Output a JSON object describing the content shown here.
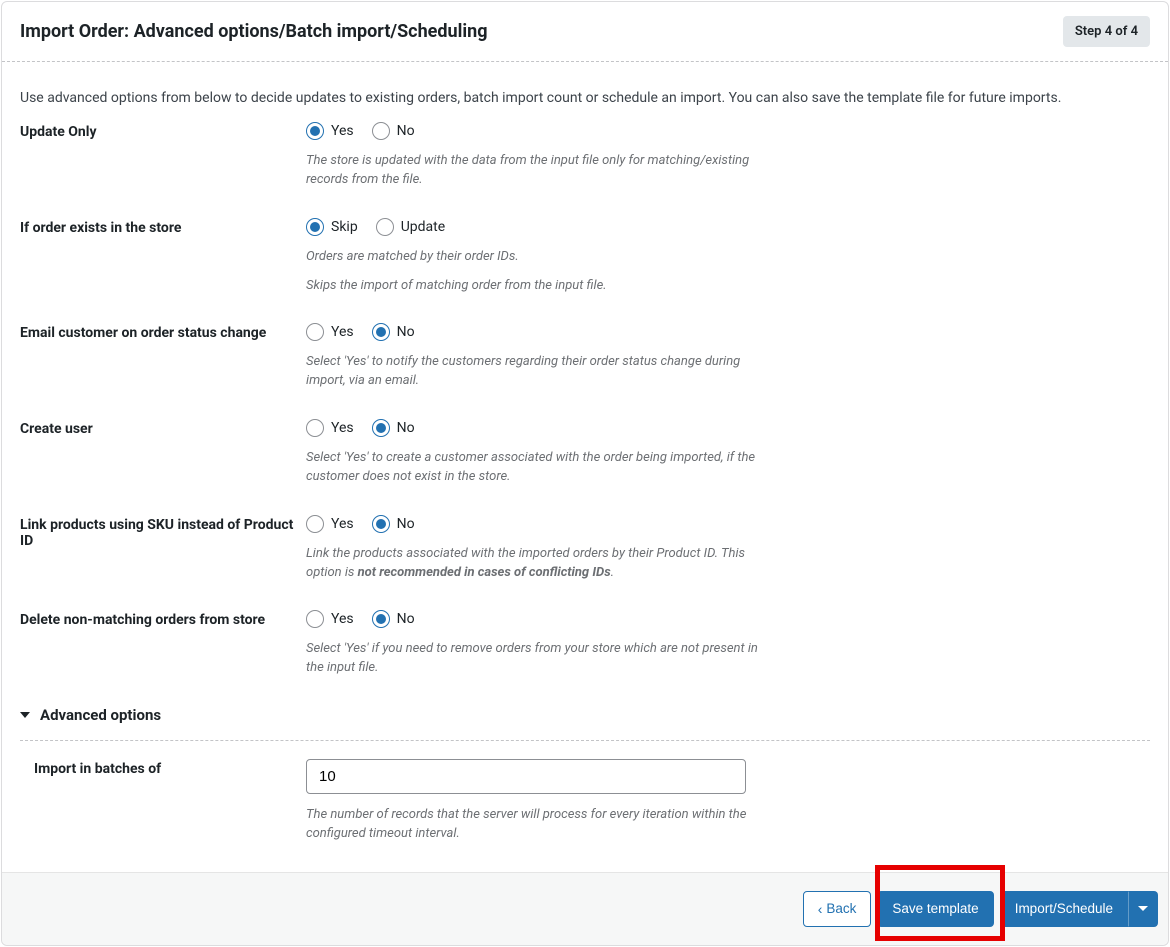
{
  "header": {
    "title": "Import Order: Advanced options/Batch import/Scheduling",
    "step_badge": "Step 4 of 4"
  },
  "intro": "Use advanced options from below to decide updates to existing orders, batch import count or schedule an import. You can also save the template file for future imports.",
  "options": {
    "update_only": {
      "label": "Update Only",
      "yes": "Yes",
      "no": "No",
      "selected": "yes",
      "help": "The store is updated with the data from the input file only for matching/existing records from the file."
    },
    "if_exists": {
      "label": "If order exists in the store",
      "skip": "Skip",
      "update": "Update",
      "selected": "skip",
      "help1": "Orders are matched by their order IDs.",
      "help2": "Skips the import of matching order from the input file."
    },
    "email_customer": {
      "label": "Email customer on order status change",
      "yes": "Yes",
      "no": "No",
      "selected": "no",
      "help": "Select 'Yes' to notify the customers regarding their order status change during import, via an email."
    },
    "create_user": {
      "label": "Create user",
      "yes": "Yes",
      "no": "No",
      "selected": "no",
      "help": "Select 'Yes' to create a customer associated with the order being imported, if the customer does not exist in the store."
    },
    "link_sku": {
      "label": "Link products using SKU instead of Product ID",
      "yes": "Yes",
      "no": "No",
      "selected": "no",
      "help_pre": "Link the products associated with the imported orders by their Product ID. This option is ",
      "help_bold": "not recommended in cases of conflicting IDs",
      "help_post": "."
    },
    "delete_nonmatch": {
      "label": "Delete non-matching orders from store",
      "yes": "Yes",
      "no": "No",
      "selected": "no",
      "help": "Select 'Yes' if you need to remove orders from your store which are not present in the input file."
    }
  },
  "advanced": {
    "heading": "Advanced options",
    "batch_label": "Import in batches of",
    "batch_value": "10",
    "batch_help": "The number of records that the server will process for every iteration within the configured timeout interval."
  },
  "footer": {
    "back": "Back",
    "save_template": "Save template",
    "import_schedule": "Import/Schedule"
  }
}
